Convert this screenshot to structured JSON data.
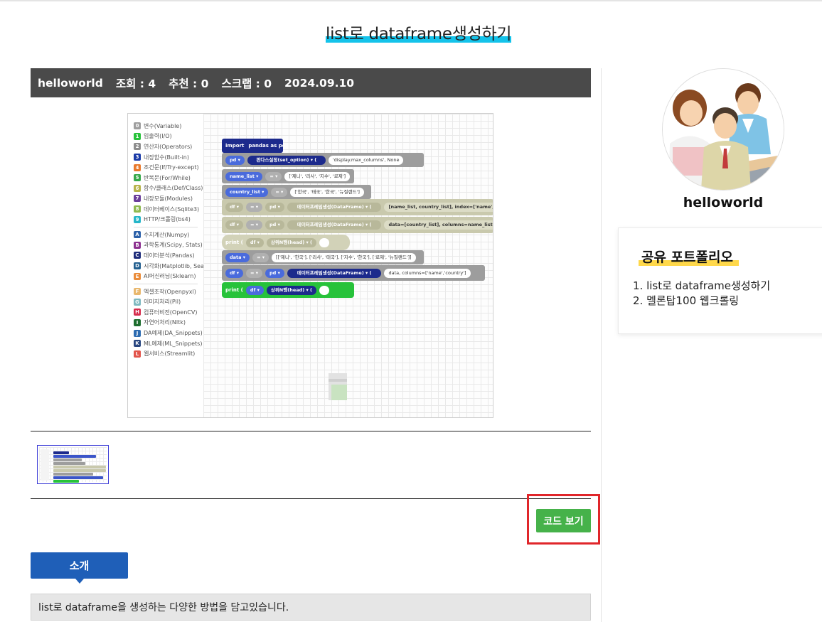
{
  "page": {
    "title": "list로 dataframe생성하기"
  },
  "post_meta": {
    "author": "helloworld",
    "views": "조회 : 4",
    "likes": "추천 : 0",
    "scraps": "스크랩 : 0",
    "date": "2024.09.10"
  },
  "editor": {
    "categories": [
      {
        "num": "0",
        "label": "변수(Variable)",
        "color": "#9e9e9e"
      },
      {
        "num": "1",
        "label": "입출력(I/O)",
        "color": "#27c23a"
      },
      {
        "num": "2",
        "label": "연산자(Operators)",
        "color": "#8d8d8d"
      },
      {
        "num": "3",
        "label": "내장함수(Built-in)",
        "color": "#1a3aa7"
      },
      {
        "num": "4",
        "label": "조건문(If/Try-except)",
        "color": "#e8792c"
      },
      {
        "num": "5",
        "label": "반복문(For/While)",
        "color": "#35a84a"
      },
      {
        "num": "6",
        "label": "함수/클래스(Def/Class)",
        "color": "#b7b34a"
      },
      {
        "num": "7",
        "label": "내장모듈(Modules)",
        "color": "#6a3d9a"
      },
      {
        "num": "8",
        "label": "데이터베이스(Sqlite3)",
        "color": "#8fb94f"
      },
      {
        "num": "9",
        "label": "HTTP/크롤링(bs4)",
        "color": "#25b6c9"
      },
      {
        "num": "A",
        "label": "수치계산(Numpy)",
        "color": "#2a5fa8"
      },
      {
        "num": "B",
        "label": "과학통계(Scipy, Stats)",
        "color": "#8b2f8f"
      },
      {
        "num": "C",
        "label": "데이터분석(Pandas)",
        "color": "#1d2b7a"
      },
      {
        "num": "D",
        "label": "시각화(Matplotlib, Seaborn)",
        "color": "#235f8f"
      },
      {
        "num": "E",
        "label": "AI머신러닝(Sklearn)",
        "color": "#ea8c3a"
      },
      {
        "num": "F",
        "label": "엑셀조작(Openpyxl)",
        "color": "#e9b86e"
      },
      {
        "num": "G",
        "label": "이미지처리(Pil)",
        "color": "#7fb9c0"
      },
      {
        "num": "H",
        "label": "컴퓨터비전(OpenCV)",
        "color": "#d62d4d"
      },
      {
        "num": "I",
        "label": "자연어처리(Nltk)",
        "color": "#1d6d2e"
      },
      {
        "num": "J",
        "label": "DA예제(DA_Snippets)",
        "color": "#2c6bb1"
      },
      {
        "num": "K",
        "label": "ML예제(ML_Snippets)",
        "color": "#27457f"
      },
      {
        "num": "L",
        "label": "웹서비스(Streamlit)",
        "color": "#e2544a"
      }
    ],
    "blocks": {
      "import_kw": "import",
      "import_mod": "pandas as pd ▾",
      "b1_var": "pd ▾",
      "b1_fn": "판다스설정(set_option) ▾ (",
      "b1_arg": "'display.max_columns', None",
      "b2_var": "name_list ▾",
      "b2_eq": "= ▾",
      "b2_val": "['제니', '리사', '지수', '로제']",
      "b3_var": "country_list ▾",
      "b3_eq": "= ▾",
      "b3_val": "['한국', '태국', '한국', '뉴질랜드']",
      "b4_var": "df ▾",
      "b4_eq": "= ▾",
      "b4_pd": "pd ▾",
      "b4_fn": "데이터프레임생성(DataFrame) ▾ (",
      "b4_arg": "[name_list, country_list], index=['name','co",
      "b5_var": "df ▾",
      "b5_eq": "= ▾",
      "b5_pd": "pd ▾",
      "b5_fn": "데이터프레임생성(DataFrame) ▾ (",
      "b5_arg": "data=[country_list], columns=name_list, in",
      "b6_kw": "print (",
      "b6_var": "df ▾",
      "b6_fn": "상위N행(head) ▾ (",
      "b7_var": "data ▾",
      "b7_eq": "= ▾",
      "b7_val": "[['제니', '한국'], ['리사', '태국'], ['지수', '한국'], ['로제', '뉴질랜드']]",
      "b8_var": "df ▾",
      "b8_eq": "= ▾",
      "b8_pd": "pd ▾",
      "b8_fn": "데이터프레임생성(DataFrame) ▾ (",
      "b8_arg": "data, columns=['name','country']",
      "b9_kw": "print (",
      "b9_var": "df ▾",
      "b9_fn": "상위N행(head) ▾ ("
    }
  },
  "code_button": "코드 보기",
  "intro": {
    "tab_label": "소개",
    "text": "list로 dataframe을 생성하는 다양한 방법을 담고있습니다."
  },
  "sidebar": {
    "username": "helloworld",
    "portfolio_title": "공유 포트폴리오",
    "portfolio_items": [
      "1. list로 dataframe생성하기",
      "2. 멜론탑100 웹크롤링"
    ]
  },
  "colors": {
    "title_highlight": "#14c3ea",
    "meta_bar": "#4a4a4a",
    "code_button": "#46b24a",
    "annotation_frame": "#e0262a",
    "intro_tab": "#1f5fb8",
    "portfolio_highlight": "#ffd84a"
  }
}
